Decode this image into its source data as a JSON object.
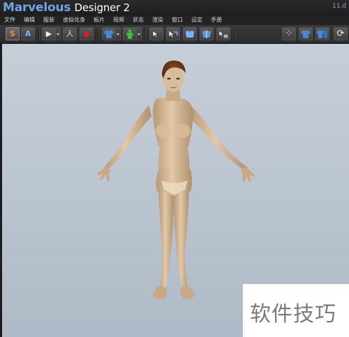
{
  "window": {
    "title_brand": "Marvelous",
    "title_product": "Designer 2",
    "corner_tag": "11.d"
  },
  "menu": {
    "items": [
      "文件",
      "编辑",
      "服装",
      "虚拟化身",
      "板片",
      "视频",
      "状态",
      "渲染",
      "窗口",
      "设定",
      "手册"
    ]
  },
  "toolbar": {
    "buttons": [
      {
        "name": "simulation-mode-button",
        "glyph": "S",
        "color": "#ff8a2a"
      },
      {
        "name": "animation-mode-button",
        "glyph": "A",
        "color": "#7ab0ff"
      },
      {
        "name": "play-button",
        "glyph": "▶",
        "color": "#e8e8e8"
      },
      {
        "name": "walk-button",
        "glyph": "人",
        "color": "#d0d0d0"
      },
      {
        "name": "record-button",
        "glyph": "●",
        "color": "#d42020"
      },
      {
        "name": "garment-button",
        "glyph": "T",
        "color": "#5a8fd8"
      },
      {
        "name": "avatar-button",
        "glyph": "☺",
        "color": "#3fbf3f"
      },
      {
        "name": "select-arrow-button",
        "glyph": "↖",
        "color": "#e8e8e8"
      },
      {
        "name": "transform-button",
        "glyph": "✥",
        "color": "#7ab0ff"
      },
      {
        "name": "fold-button",
        "glyph": "⋈",
        "color": "#7ab0ff"
      },
      {
        "name": "flip-button",
        "glyph": "⋈",
        "color": "#7ab0ff"
      },
      {
        "name": "pin-button",
        "glyph": "↖",
        "color": "#e8e8e8"
      },
      {
        "name": "points-button",
        "glyph": "⁘",
        "color": "#e8e8e8"
      },
      {
        "name": "garment-front-button",
        "glyph": "T",
        "color": "#5a8fd8"
      },
      {
        "name": "garment-back-button",
        "glyph": "T",
        "color": "#5a8fd8"
      },
      {
        "name": "reset-button",
        "glyph": "⟳",
        "color": "#e8e8e8"
      }
    ]
  },
  "watermark": {
    "text": "软件技巧"
  }
}
